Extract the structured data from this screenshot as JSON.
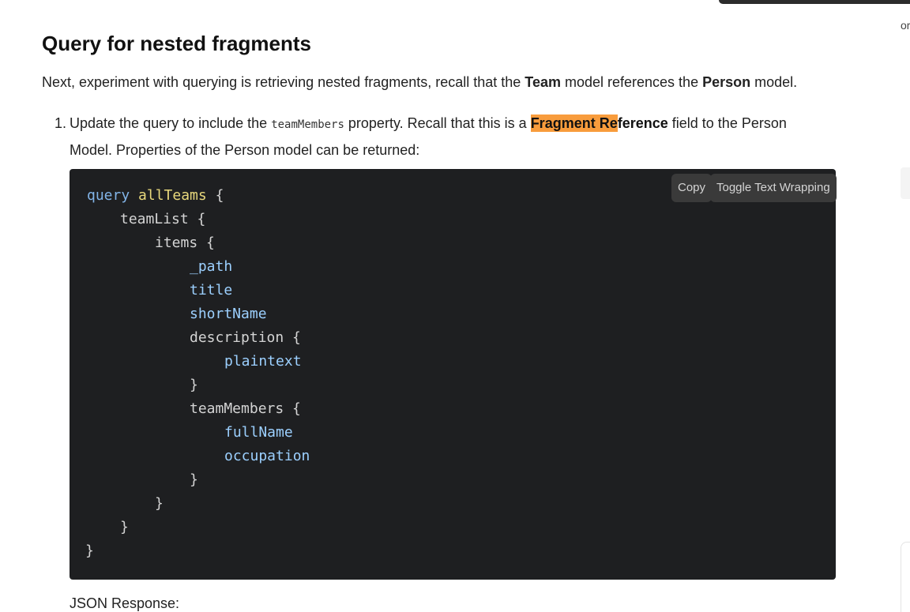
{
  "section": {
    "title": "Query for nested fragments",
    "intro": {
      "t1": "Next, experiment with querying is retrieving nested fragments, recall that the ",
      "b1": "Team",
      "t2": " model references the ",
      "b2": "Person",
      "t3": " model."
    }
  },
  "step": {
    "number": "1.",
    "t1": "Update the query to include the ",
    "code": "teamMembers",
    "t2": " property. Recall that this is a ",
    "hl1": "Fragment Re",
    "hl2": "ference",
    "t3": " field to the Person Model. Properties of the Person model can be returned:"
  },
  "code": {
    "copy_label": "Copy",
    "wrap_label": "Toggle Text Wrapping",
    "lines": {
      "l1_kw": "query",
      "l1_name": "allTeams",
      "brace_open": " {",
      "brace_close": "}",
      "l2": "teamList",
      "l3": "items",
      "l4": "_path",
      "l5": "title",
      "l6": "shortName",
      "l7": "description",
      "l8": "plaintext",
      "l10": "teamMembers",
      "l11": "fullName",
      "l12": "occupation"
    }
  },
  "json_label": "JSON Response:",
  "edge_text": "or"
}
